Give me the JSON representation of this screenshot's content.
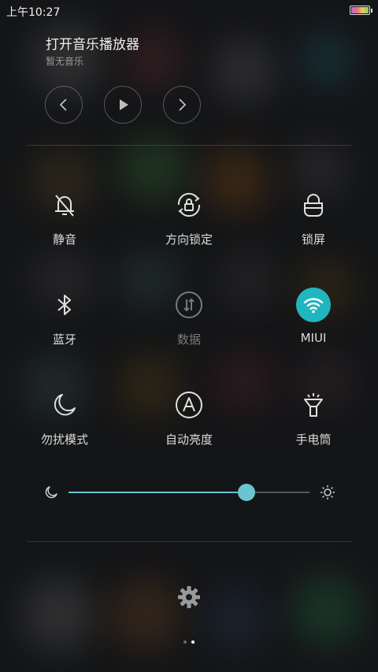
{
  "status_bar": {
    "time": "上午10:27",
    "battery_icon": "battery-icon"
  },
  "music": {
    "title": "打开音乐播放器",
    "subtitle": "暂无音乐",
    "controls": [
      "previous-icon",
      "play-icon",
      "next-icon"
    ]
  },
  "toggles": [
    {
      "label": "静音",
      "icon": "bell-off-icon",
      "state": "off"
    },
    {
      "label": "方向锁定",
      "icon": "rotation-lock-icon",
      "state": "off"
    },
    {
      "label": "锁屏",
      "icon": "lock-icon",
      "state": "off"
    },
    {
      "label": "蓝牙",
      "icon": "bluetooth-icon",
      "state": "off"
    },
    {
      "label": "数据",
      "icon": "mobile-data-icon",
      "state": "disabled"
    },
    {
      "label": "MIUI",
      "icon": "wifi-icon",
      "state": "on"
    },
    {
      "label": "勿扰模式",
      "icon": "moon-icon",
      "state": "off"
    },
    {
      "label": "自动亮度",
      "icon": "auto-brightness-icon",
      "state": "off"
    },
    {
      "label": "手电筒",
      "icon": "flashlight-icon",
      "state": "off"
    }
  ],
  "brightness": {
    "level_fraction": 0.74,
    "low_icon": "moon-small-icon",
    "high_icon": "sun-icon"
  },
  "footer": {
    "settings_icon": "gear-icon",
    "pages": 2,
    "current_page": 2
  },
  "colors": {
    "accent": "#20b6c0",
    "slider": "#6cc4d0",
    "background": "#141517"
  }
}
